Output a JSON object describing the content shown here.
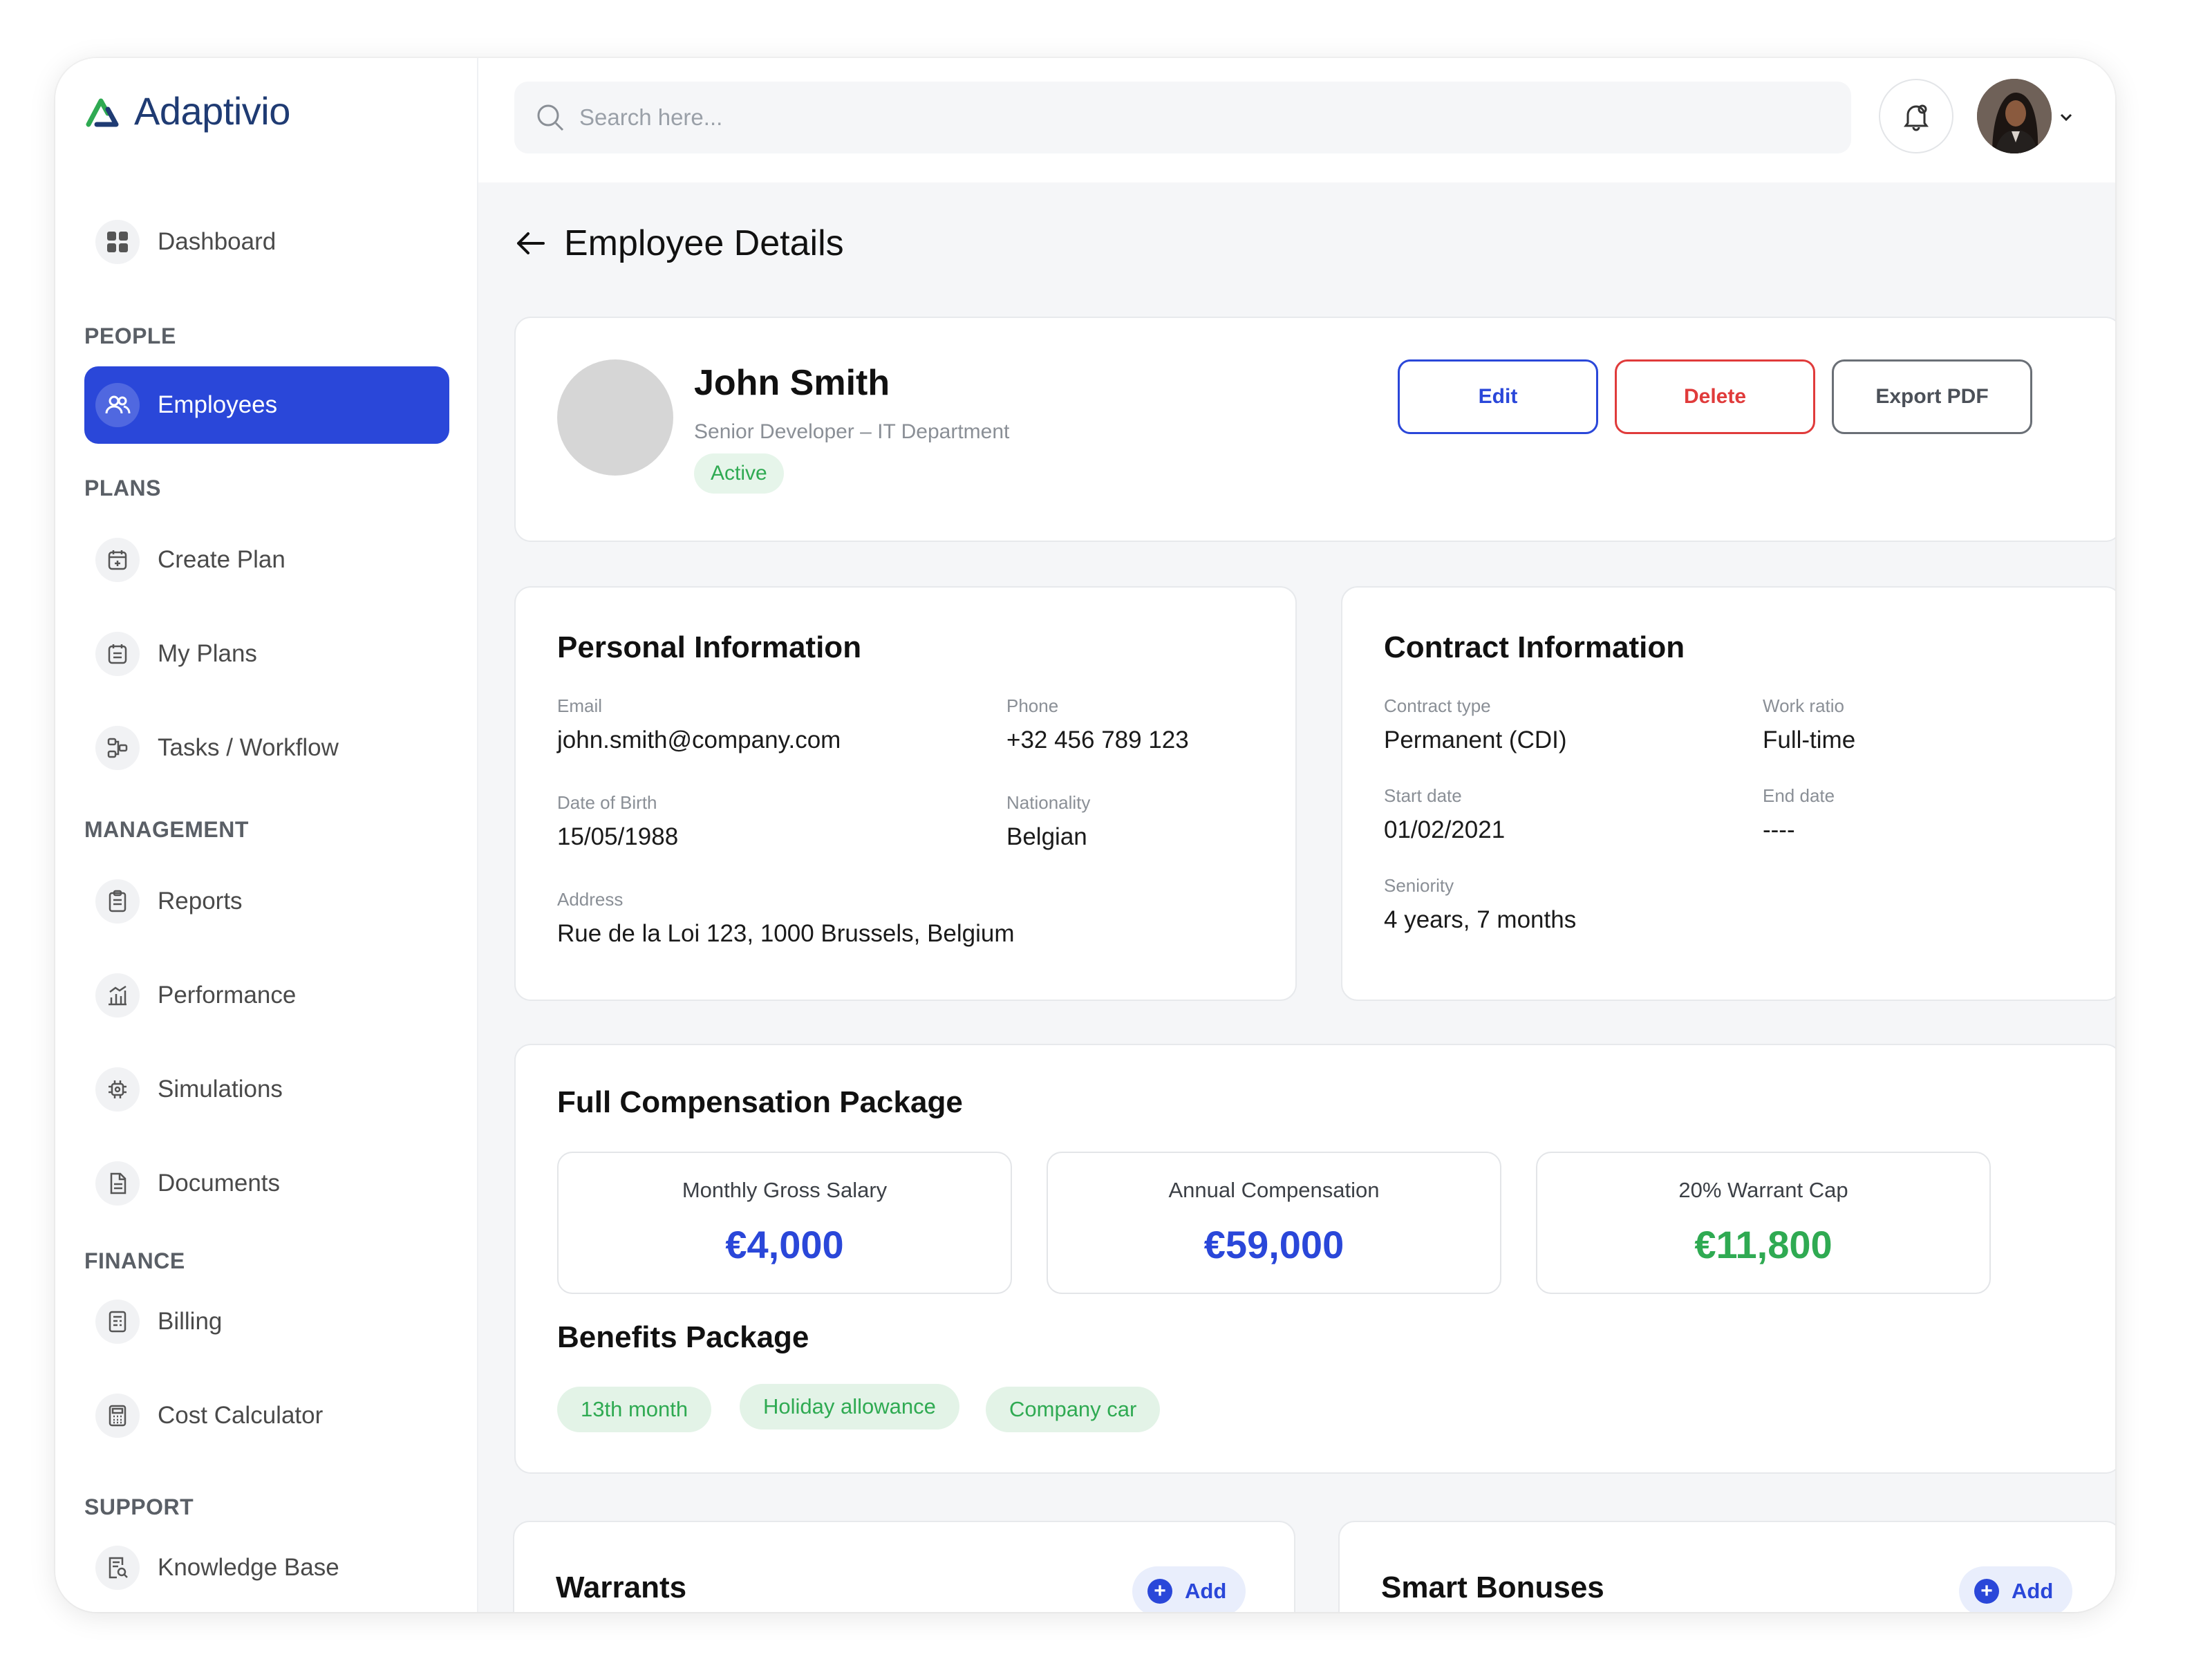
{
  "app": {
    "name": "Adaptivio"
  },
  "colors": {
    "accent": "#2a47d9",
    "danger": "#e03b3b",
    "success": "#2faa52"
  },
  "sidebar": {
    "dashboard": "Dashboard",
    "sections": {
      "people": "PEOPLE",
      "plans": "PLANS",
      "management": "MANAGEMENT",
      "finance": "FINANCE",
      "support": "SUPPORT"
    },
    "items": {
      "employees": "Employees",
      "create_plan": "Create Plan",
      "my_plans": "My Plans",
      "tasks": "Tasks / Workflow",
      "reports": "Reports",
      "performance": "Performance",
      "simulations": "Simulations",
      "documents": "Documents",
      "billing": "Billing",
      "cost_calculator": "Cost Calculator",
      "knowledge_base": "Knowledge Base"
    }
  },
  "search": {
    "placeholder": "Search here..."
  },
  "page": {
    "title": "Employee Details"
  },
  "profile": {
    "name": "John Smith",
    "role": "Senior Developer – IT Department",
    "status": "Active",
    "buttons": {
      "edit": "Edit",
      "delete": "Delete",
      "export": "Export PDF"
    }
  },
  "personal": {
    "title": "Personal Information",
    "email_label": "Email",
    "email": "john.smith@company.com",
    "phone_label": "Phone",
    "phone": "+32 456 789 123",
    "dob_label": "Date of Birth",
    "dob": "15/05/1988",
    "nationality_label": "Nationality",
    "nationality": "Belgian",
    "address_label": "Address",
    "address": "Rue de la Loi 123, 1000 Brussels, Belgium"
  },
  "contract": {
    "title": "Contract Information",
    "type_label": "Contract type",
    "type": "Permanent (CDI)",
    "ratio_label": "Work ratio",
    "ratio": "Full-time",
    "start_label": "Start date",
    "start": "01/02/2021",
    "end_label": "End date",
    "end": "----",
    "seniority_label": "Seniority",
    "seniority": "4 years, 7 months"
  },
  "compensation": {
    "title": "Full Compensation Package",
    "monthly_label": "Monthly Gross Salary",
    "monthly": "€4,000",
    "annual_label": "Annual Compensation",
    "annual": "€59,000",
    "warrant_label": "20% Warrant Cap",
    "warrant": "€11,800",
    "benefits_title": "Benefits Package",
    "benefits": [
      "13th month",
      "Holiday allowance",
      "Company car"
    ]
  },
  "warrants": {
    "title": "Warrants",
    "add": "Add"
  },
  "bonuses": {
    "title": "Smart Bonuses",
    "add": "Add"
  }
}
